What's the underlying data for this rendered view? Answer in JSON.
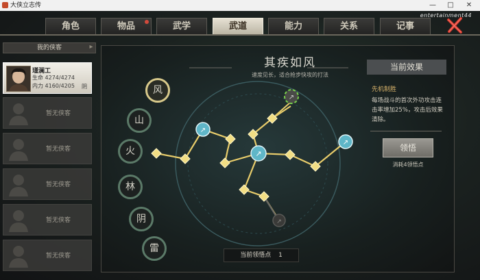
{
  "window": {
    "title": "大侠立志传",
    "minimize_glyph": "—",
    "maximize_glyph": "□",
    "close_glyph": "✕"
  },
  "watermark": "entertainment44",
  "tabs": [
    {
      "label": "角色",
      "active": false,
      "badge": false
    },
    {
      "label": "物品",
      "active": false,
      "badge": true
    },
    {
      "label": "武学",
      "active": false,
      "badge": false
    },
    {
      "label": "武道",
      "active": true,
      "badge": false
    },
    {
      "label": "能力",
      "active": false,
      "badge": false
    },
    {
      "label": "关系",
      "active": false,
      "badge": false
    },
    {
      "label": "记事",
      "active": false,
      "badge": false
    }
  ],
  "sidebar": {
    "header": "我的侠客",
    "hero": {
      "name": "瑾澜工",
      "hp": "生命 4274/4274",
      "mp": "内力 4160/4205",
      "stance": "阴"
    },
    "empty_label": "暂无侠客",
    "empty_slots": 5
  },
  "skill_tree": {
    "title": "其疾如风",
    "subtitle": "速度见长，适合抢步快攻的打法",
    "stances": [
      "风",
      "山",
      "火",
      "林",
      "阴",
      "雷"
    ],
    "selected_stance": "风",
    "points_label": "当前领悟点",
    "points_value": "1"
  },
  "effect_panel": {
    "title": "当前效果",
    "effect_name": "先机制胜",
    "effect_desc": "每场战斗的首次外功攻击连击率增加25%，攻击后效果清除。",
    "button_label": "领悟",
    "cost": "消耗4领悟点"
  },
  "colors": {
    "accent_gold": "#e8cf6a",
    "node_teal": "#5fb6c8",
    "close_red": "#d23a2e",
    "active_tab": "#d9d3c3"
  }
}
